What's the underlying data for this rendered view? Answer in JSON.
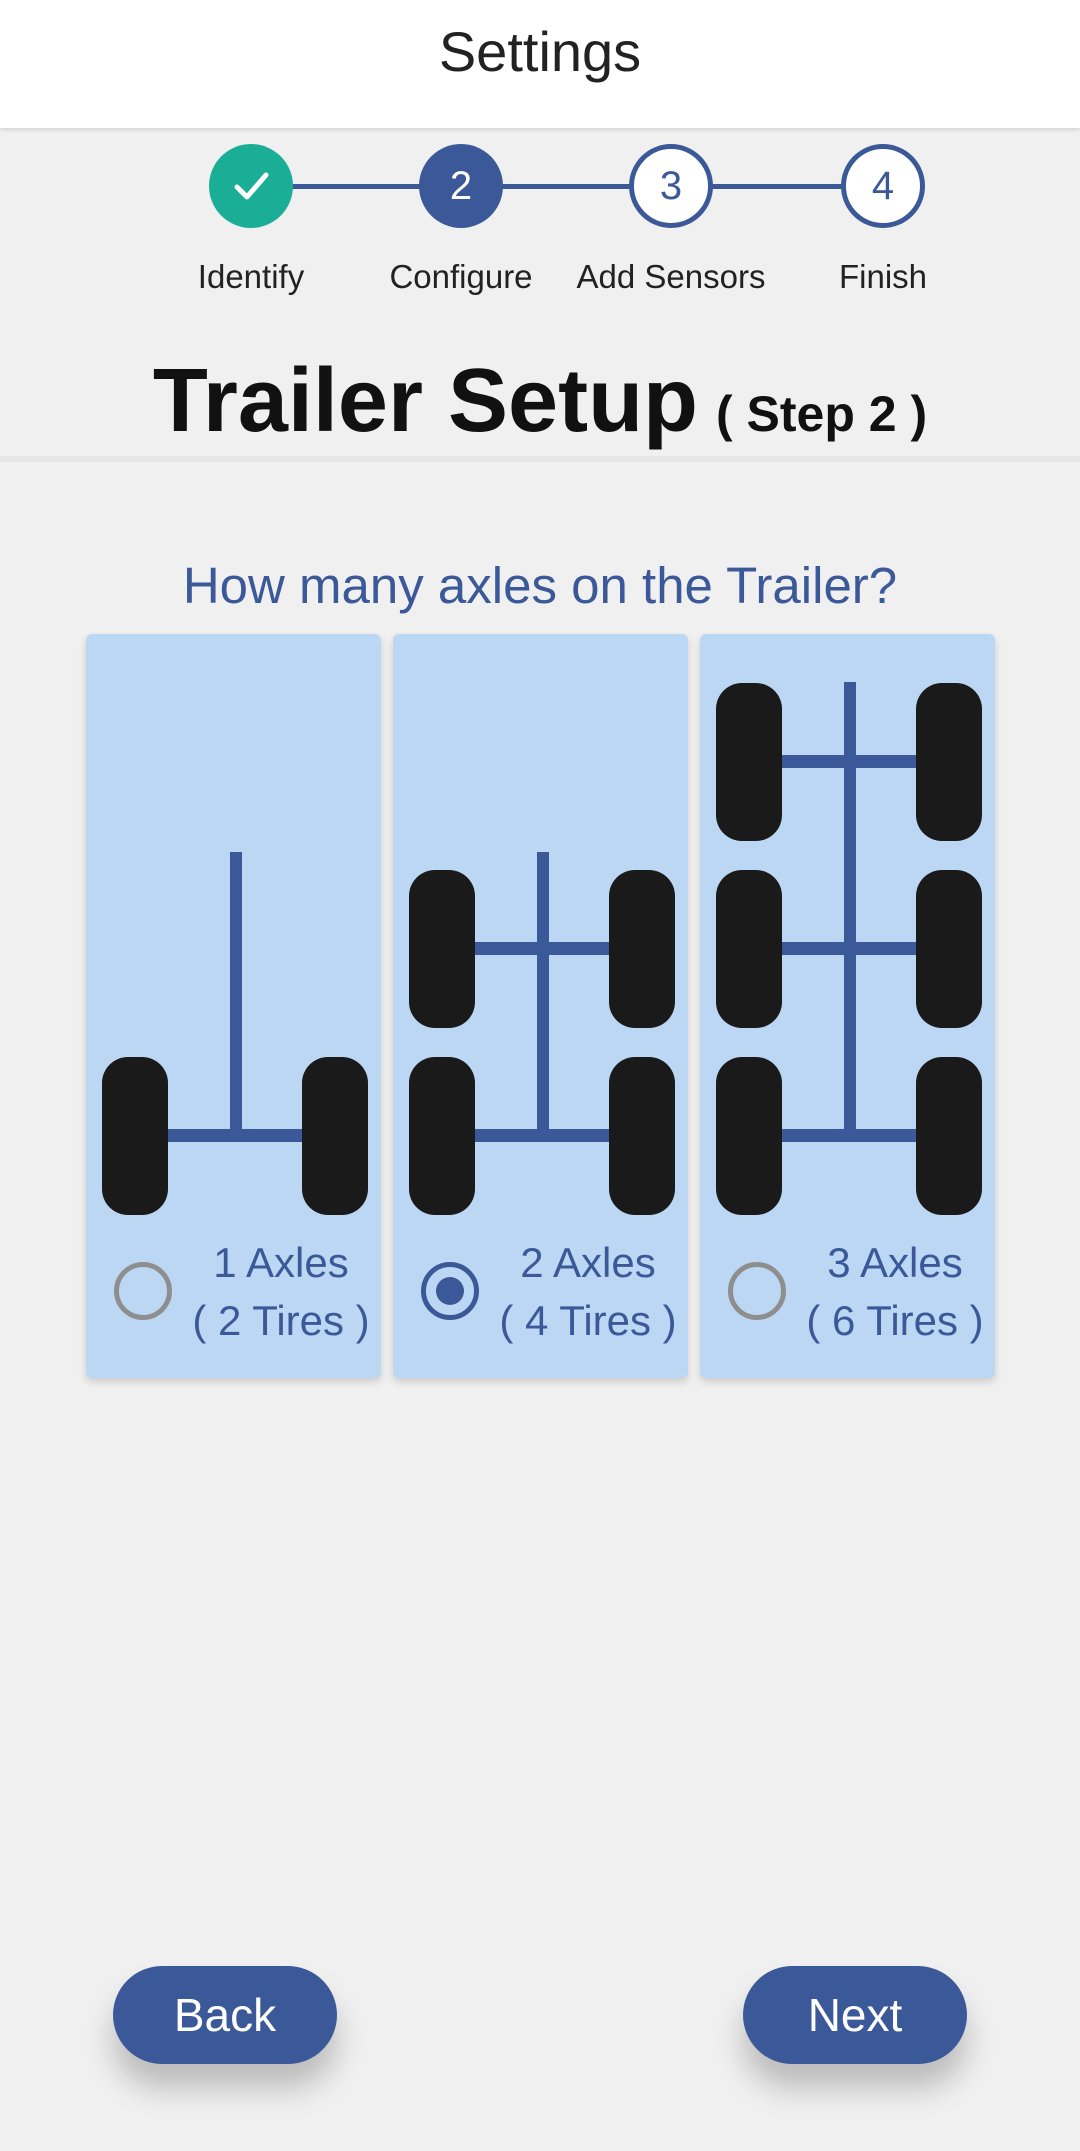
{
  "app": {
    "title": "Settings"
  },
  "stepper": {
    "steps": [
      {
        "label": "Identify",
        "number": "",
        "state": "done",
        "icon": "check-icon"
      },
      {
        "label": "Configure",
        "number": "2",
        "state": "active"
      },
      {
        "label": "Add Sensors",
        "number": "3",
        "state": "todo"
      },
      {
        "label": "Finish",
        "number": "4",
        "state": "todo"
      }
    ]
  },
  "page": {
    "title": "Trailer Setup",
    "step_label": "( Step 2 )",
    "question": "How many axles on the Trailer?"
  },
  "options": [
    {
      "line1": "1 Axles",
      "line2": "( 2 Tires )",
      "selected": false
    },
    {
      "line1": "2 Axles",
      "line2": "( 4 Tires )",
      "selected": true
    },
    {
      "line1": "3 Axles",
      "line2": "( 6 Tires )",
      "selected": false
    }
  ],
  "buttons": {
    "back": "Back",
    "next": "Next"
  },
  "colors": {
    "primary": "#3b5998",
    "done": "#1bae96",
    "card": "#bcd7f3",
    "tire": "#1a1a1a",
    "background": "#f0f0f0"
  }
}
